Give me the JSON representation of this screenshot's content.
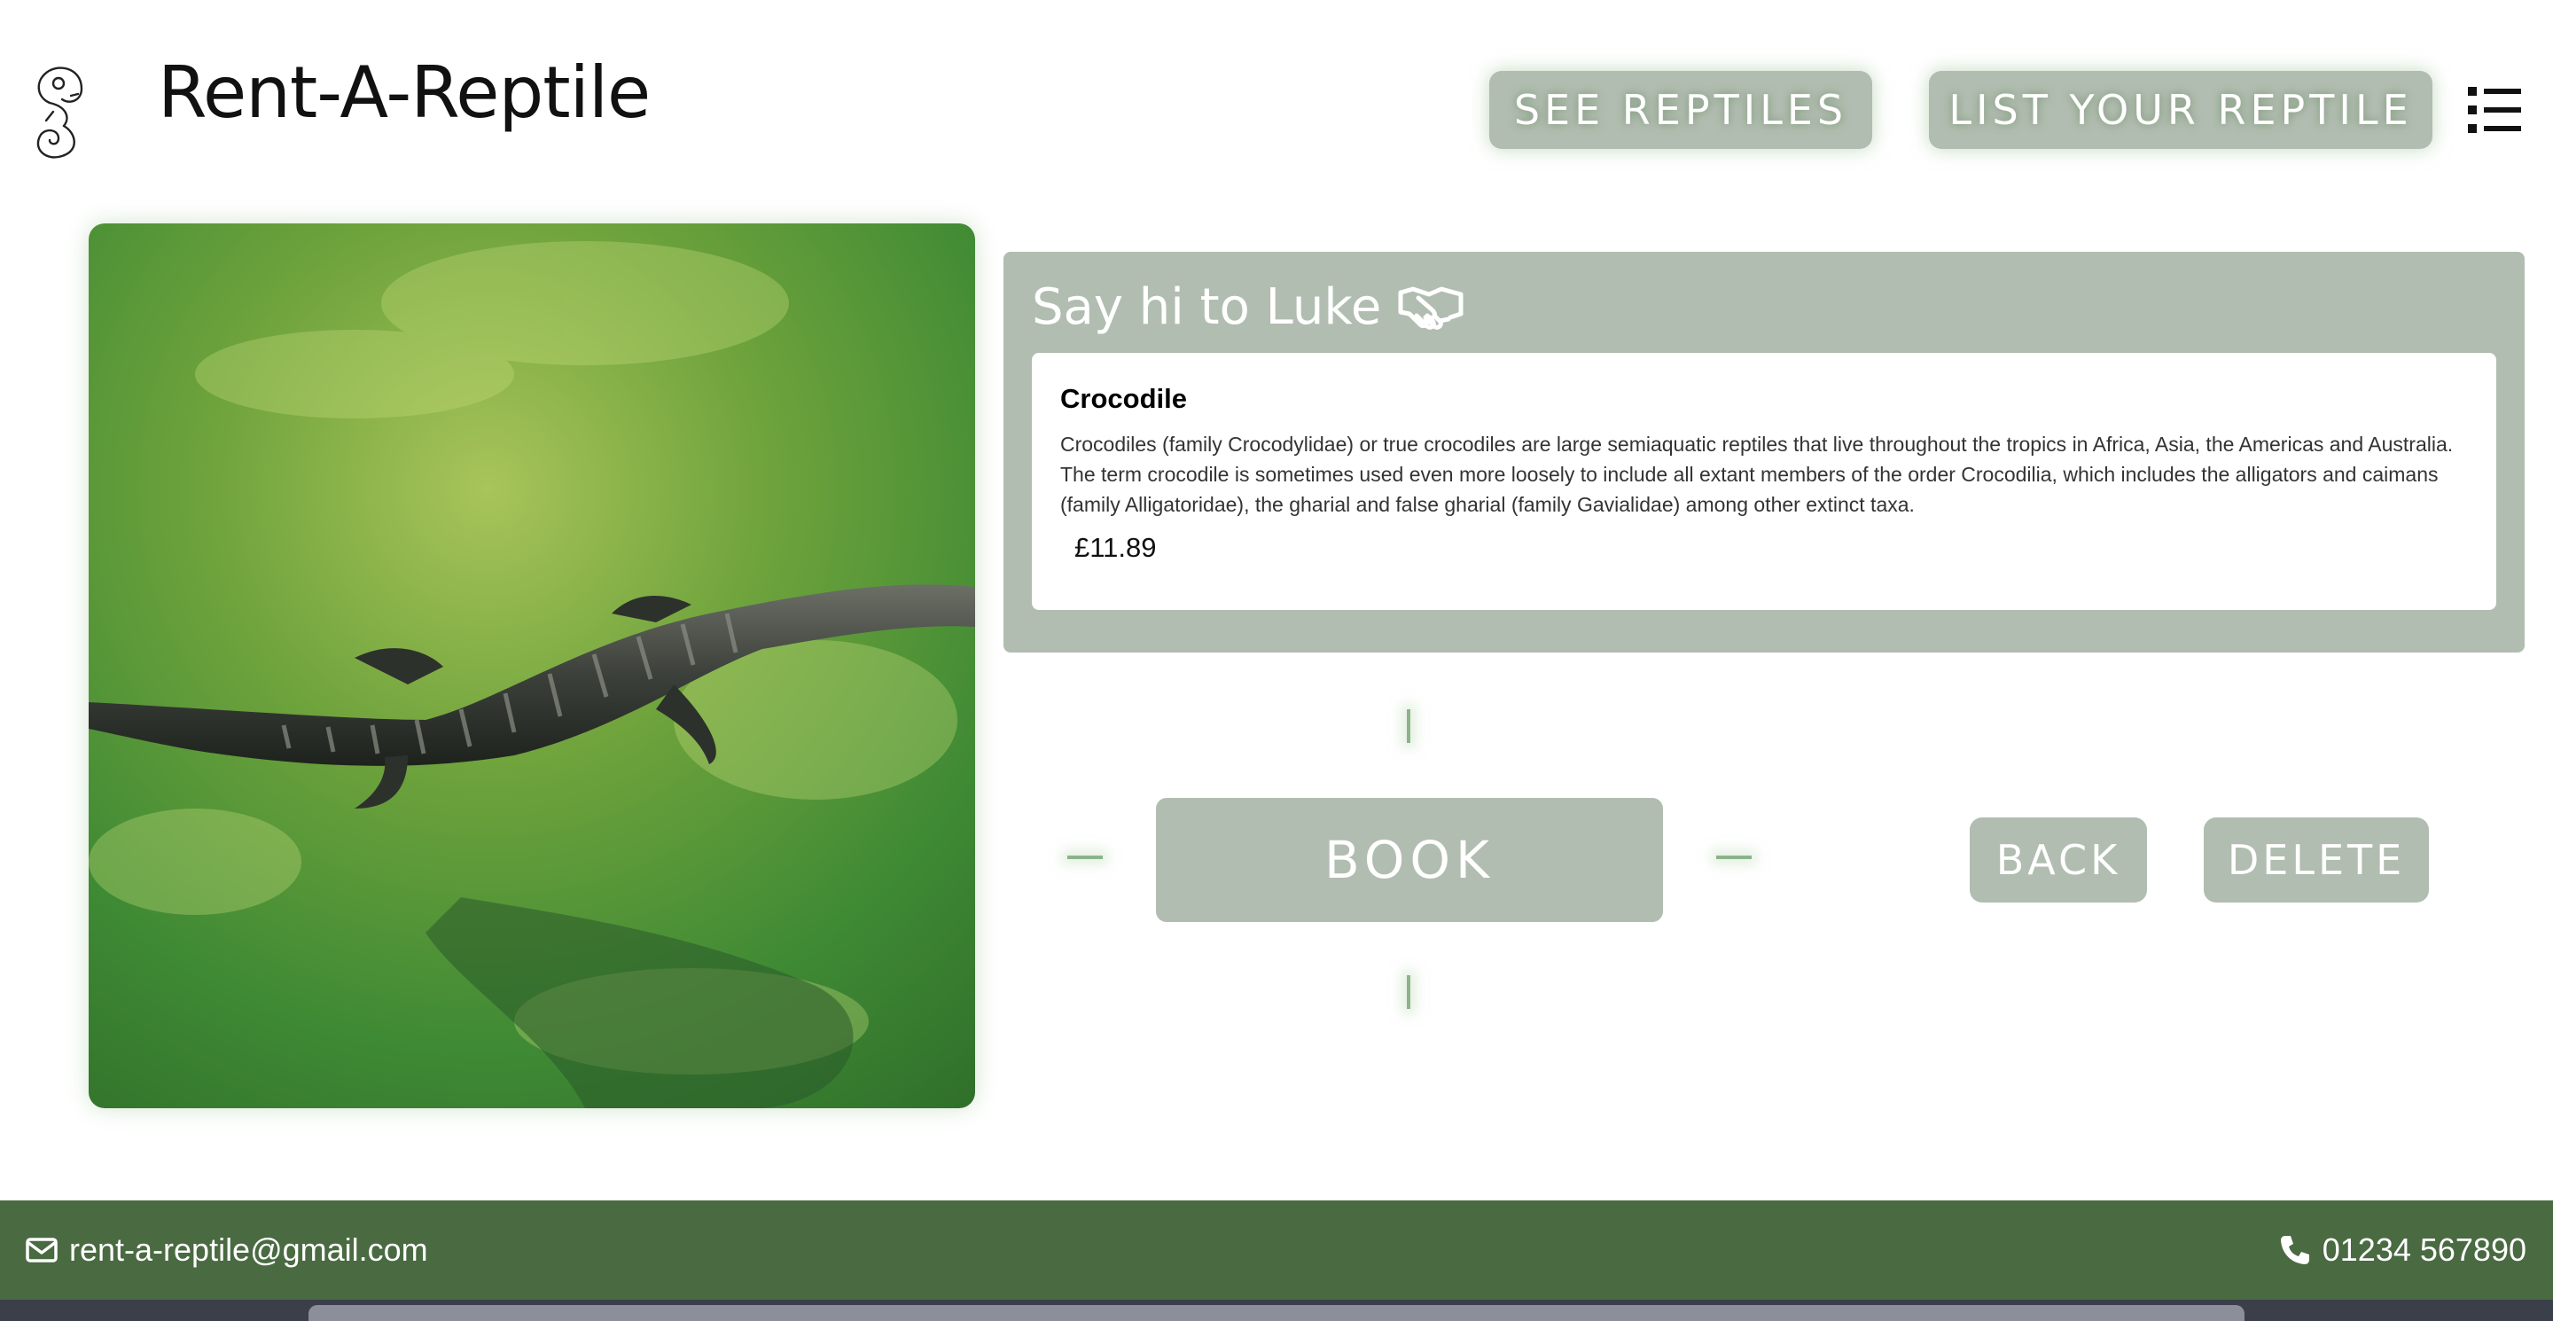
{
  "header": {
    "logo_icon": "chameleon-logo-icon",
    "title": "Rent-A-Reptile",
    "nav": {
      "see_reptiles": "SEE REPTILES",
      "list_your_reptile": "LIST YOUR REPTILE"
    },
    "menu_icon": "list-menu-icon"
  },
  "reptile": {
    "photo_icon": "crocodile-photo",
    "heading": "Say hi to Luke",
    "heading_icon": "handshake-icon",
    "species": "Crocodile",
    "description": "Crocodiles (family Crocodylidae) or true crocodiles are large semiaquatic reptiles that live throughout the tropics in Africa, Asia, the Americas and Australia. The term crocodile is sometimes used even more loosely to include all extant members of the order Crocodilia, which includes the alligators and caimans (family Alligatoridae), the gharial and false gharial (family Gavialidae) among other extinct taxa.",
    "price": "£11.89"
  },
  "actions": {
    "book": "BOOK",
    "back": "BACK",
    "delete": "DELETE"
  },
  "footer": {
    "email": "rent-a-reptile@gmail.com",
    "email_icon": "envelope-icon",
    "phone": "01234 567890",
    "phone_icon": "phone-icon"
  },
  "colors": {
    "sage": "#b1bdb0",
    "footer_green": "#4a6a42",
    "tick_green": "#8bb38a"
  }
}
